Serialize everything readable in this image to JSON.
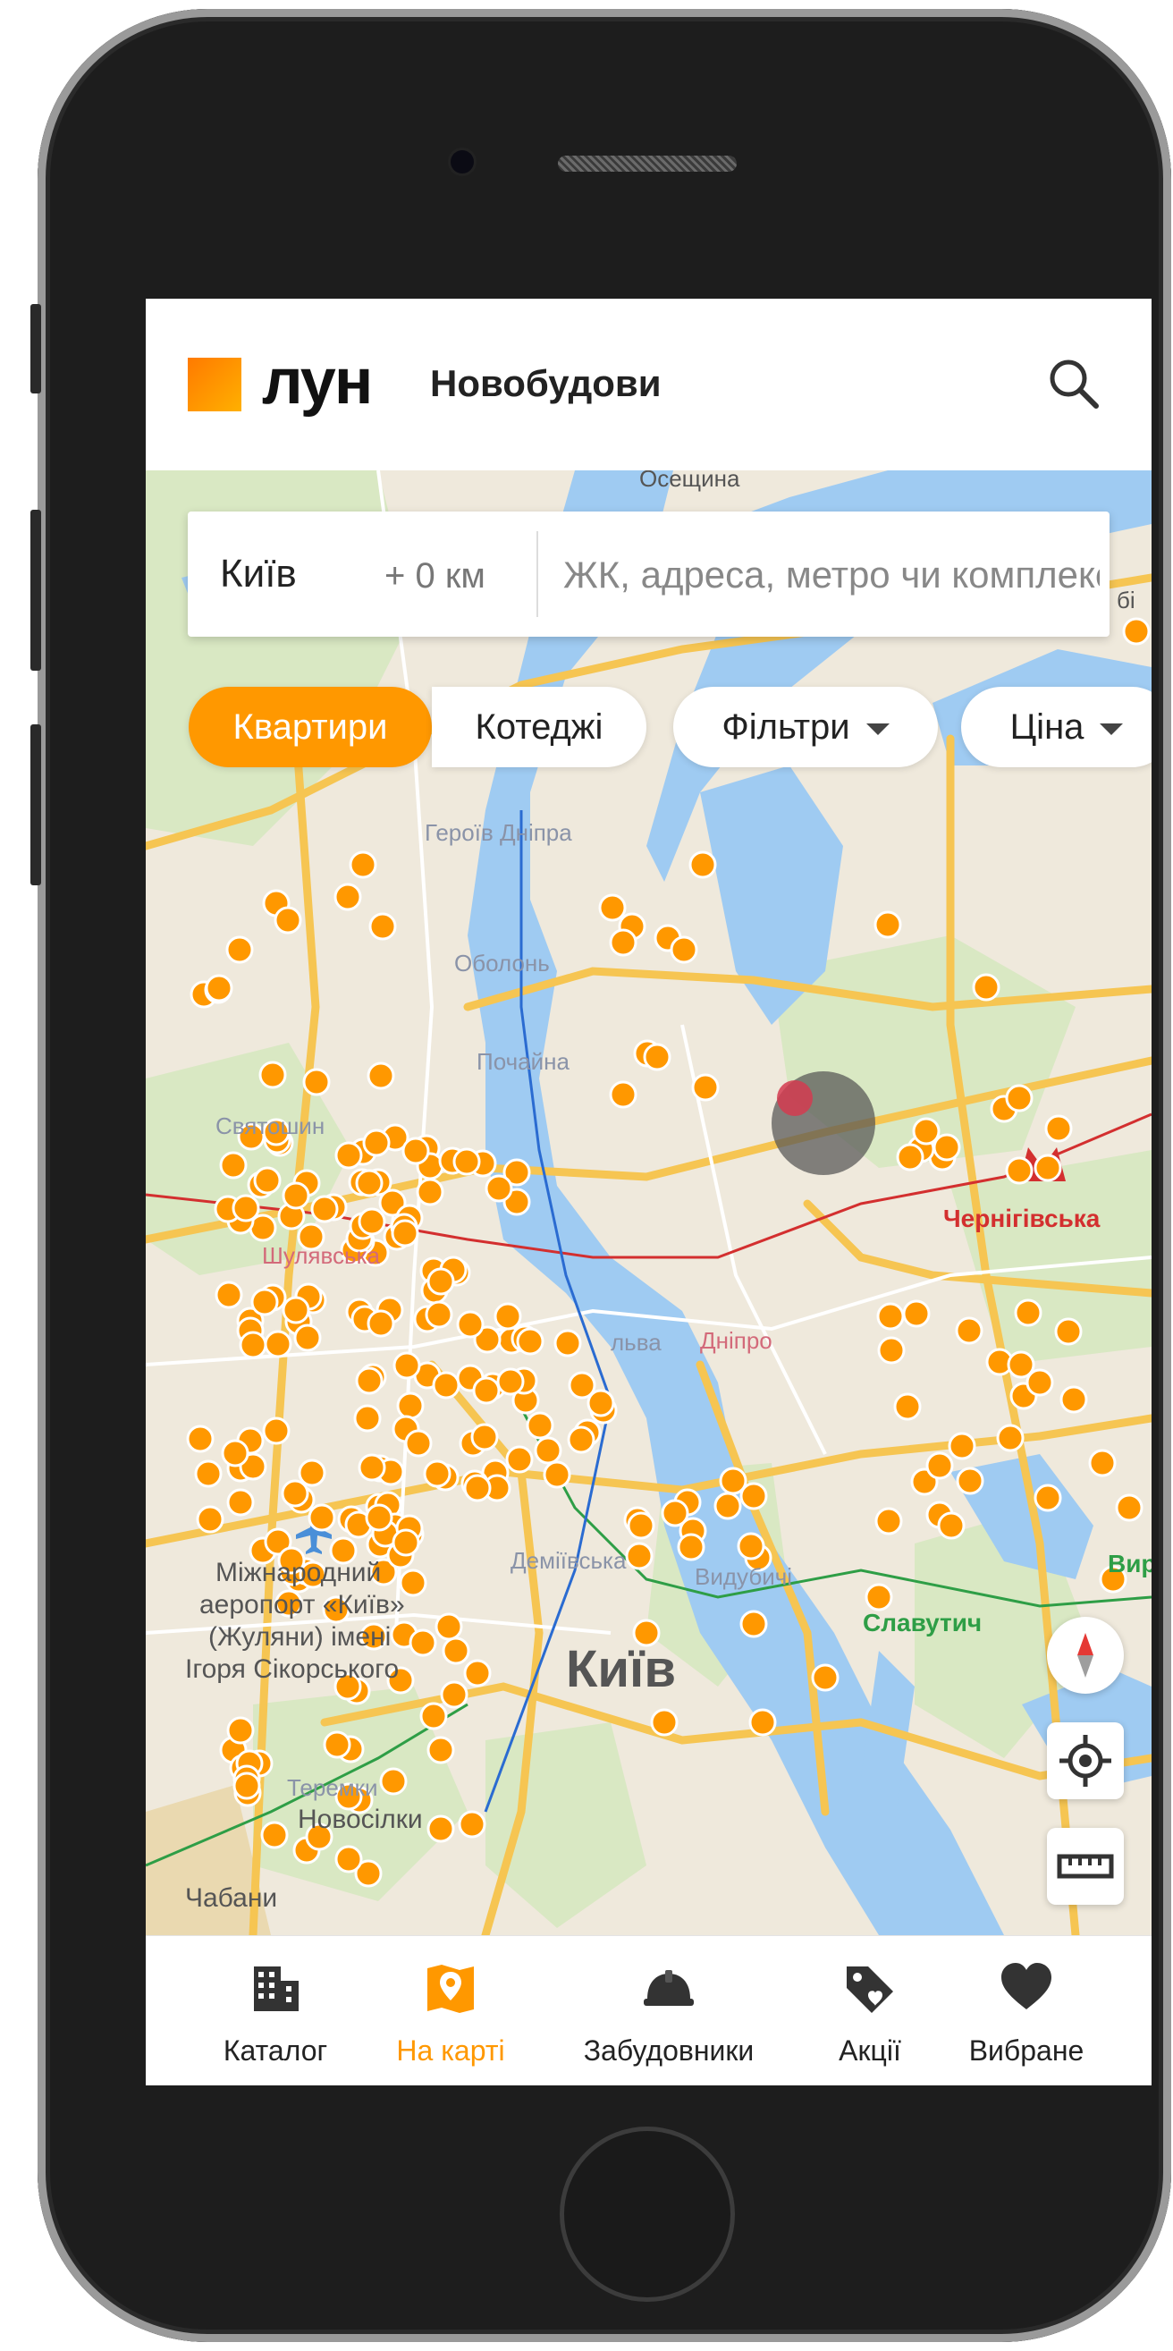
{
  "app": {
    "logo_text": "лун",
    "brand_subtitle": "Новобудови",
    "accent_color": "#ff9800"
  },
  "header": {
    "search_icon": "search-icon"
  },
  "search": {
    "city": "Київ",
    "radius": "+ 0 км",
    "placeholder": "ЖК, адреса, метро чи комплекс"
  },
  "filters": {
    "chips": [
      {
        "label": "Квартири",
        "active": true
      },
      {
        "label": "Котеджі",
        "active": false
      },
      {
        "label": "Фільтри",
        "dropdown": true
      },
      {
        "label": "Ціна",
        "dropdown": true
      }
    ]
  },
  "map": {
    "city_label": "Київ",
    "labels": {
      "oseshchyna": "Осещина",
      "heroiv_dnipra": "Героїв Дніпра",
      "obolon": "Оболонь",
      "pochaina": "Почайна",
      "sviatoshyn": "Святошин",
      "shuliavska": "Шулявська",
      "chernihivska": "Чернігівська",
      "dnipro": "Дніпро",
      "lva": "льва",
      "demiivska": "Деміївська",
      "vydubychi": "Видубичі",
      "slavutych": "Славутич",
      "vyr": "Вир",
      "airport_line1": "Міжнародний",
      "airport_line2": "аеропорт «Київ»",
      "airport_line3": "(Жуляни) імені",
      "airport_line4": "Ігоря Сікорського",
      "teremky": "Теремки",
      "novosilky": "Новосілки",
      "chabany": "Чабани",
      "brovary_edge": "бі"
    },
    "controls": {
      "compass": "compass-icon",
      "locate": "locate-icon",
      "ruler": "ruler-icon"
    }
  },
  "bottom_nav": {
    "items": [
      {
        "label": "Каталог",
        "icon": "building-icon",
        "active": false
      },
      {
        "label": "На карті",
        "icon": "map-pin-icon",
        "active": true
      },
      {
        "label": "Забудовники",
        "icon": "hardhat-icon",
        "active": false
      },
      {
        "label": "Акції",
        "icon": "tag-icon",
        "active": false
      },
      {
        "label": "Вибране",
        "icon": "heart-icon",
        "active": false
      }
    ]
  }
}
